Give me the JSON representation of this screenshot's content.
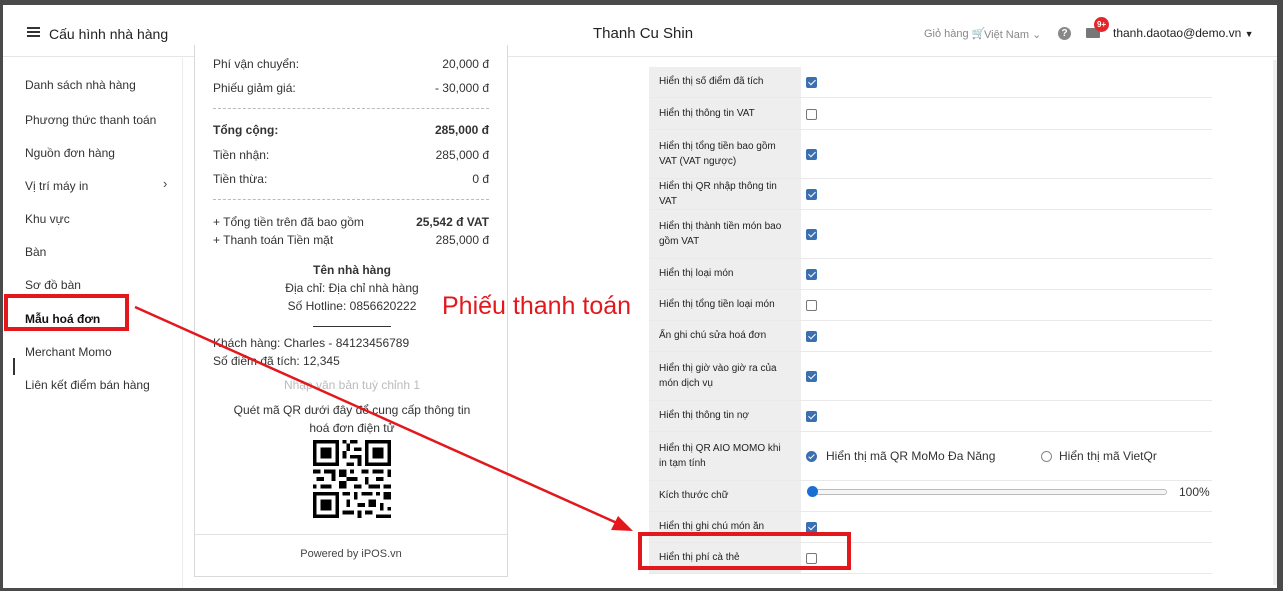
{
  "header": {
    "app_title": "Cấu hình nhà hàng",
    "shop_name": "Thanh Cu Shin",
    "cart": "Giỏ hàng",
    "language": "Việt Nam",
    "notif_badge": "9+",
    "user": "thanh.daotao@demo.vn"
  },
  "sidebar": {
    "items": [
      {
        "label": "Danh sách nhà hàng"
      },
      {
        "label": "Phương thức thanh toán"
      },
      {
        "label": "Nguồn đơn hàng"
      },
      {
        "label": "Vị trí máy in"
      },
      {
        "label": "Khu vực"
      },
      {
        "label": "Bàn"
      },
      {
        "label": "Sơ đồ bàn"
      },
      {
        "label": "Mẫu hoá đơn"
      },
      {
        "label": "Merchant Momo"
      },
      {
        "label": "Liên kết điểm bán hàng"
      }
    ],
    "selected": "Mẫu hoá đơn"
  },
  "receipt": {
    "shipping_label": "Phí vận chuyển:",
    "shipping_value": "20,000 đ",
    "discount_label": "Phiếu giảm giá:",
    "discount_value": "- 30,000 đ",
    "total_label": "Tổng cộng:",
    "total_value": "285,000 đ",
    "received_label": "Tiền nhận:",
    "received_value": "285,000 đ",
    "change_label": "Tiền thừa:",
    "change_value": "0 đ",
    "vat_label": "+ Tổng tiền trên đã bao gồm",
    "vat_value": "25,542 đ VAT",
    "cash_label": "+ Thanh toán Tiền mặt",
    "cash_value": "285,000 đ",
    "restaurant_name": "Tên nhà hàng",
    "address": "Địa chỉ: Địa chỉ nhà hàng",
    "hotline": "Số Hotline: 0856620222",
    "customer": "Khách hàng: Charles - 84123456789",
    "points": "Số điểm đã tích: 12,345",
    "custom_text": "Nhập văn bản tuỳ chỉnh 1",
    "qr_note_1": "Quét mã QR dưới đây để cung cấp thông tin",
    "qr_note_2": "hoá đơn điện tử",
    "powered": "Powered by iPOS.vn"
  },
  "options": [
    {
      "label": "Hiển thị số điểm đã tích",
      "checked": true
    },
    {
      "label": "Hiển thị thông tin VAT",
      "checked": false
    },
    {
      "label": "Hiển thị tổng tiền bao gồm VAT (VAT ngược)",
      "checked": true
    },
    {
      "label": "Hiển thị QR nhập thông tin VAT",
      "checked": true
    },
    {
      "label": "Hiển thị thành tiền món bao gồm VAT",
      "checked": true
    },
    {
      "label": "Hiển thị loại món",
      "checked": true
    },
    {
      "label": "Hiển thị tổng tiền loại món",
      "checked": false
    },
    {
      "label": "Ẩn ghi chú sửa hoá đơn",
      "checked": true
    },
    {
      "label": "Hiển thị giờ vào giờ ra của món dịch vụ",
      "checked": true
    },
    {
      "label": "Hiển thị thông tin nợ",
      "checked": true
    },
    {
      "label": "Hiển thị QR AIO MOMO khi in tạm tính",
      "radio_1": "Hiển thị mã QR MoMo Đa Năng",
      "radio_2": "Hiển thị mã VietQr",
      "selected": "Hiển thị mã QR MoMo Đa Năng"
    },
    {
      "label": "Kích thước chữ",
      "value": "100%",
      "level": 0
    },
    {
      "label": "Hiển thị ghi chú món ăn",
      "checked": true
    },
    {
      "label": "Hiển thị phí cà thẻ",
      "checked": false
    }
  ],
  "annotation": {
    "label": "Phiếu thanh toán",
    "color": "#e3181c"
  }
}
